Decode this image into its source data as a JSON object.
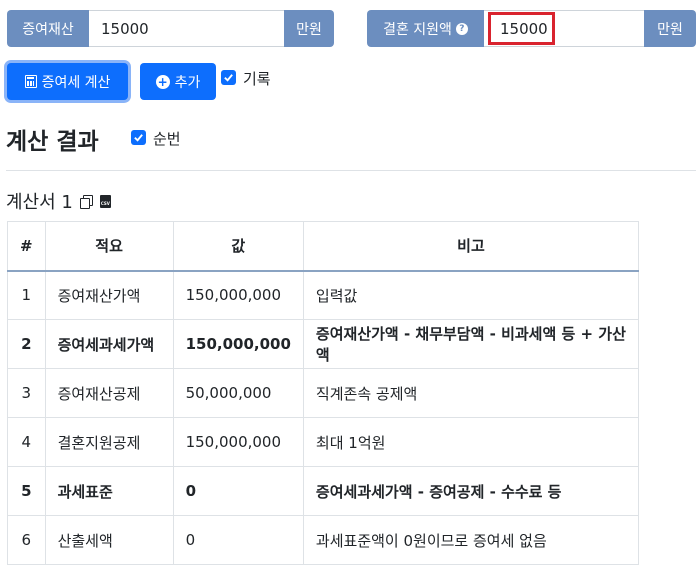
{
  "inputs": {
    "gift_property": {
      "label": "증여재산",
      "value": "15000",
      "unit": "만원"
    },
    "marriage_support": {
      "label": "결혼 지원액",
      "help": "?",
      "value": "15000",
      "unit": "만원"
    }
  },
  "buttons": {
    "calculate": "증여세 계산",
    "add": "추가",
    "add_icon": "+"
  },
  "record_checkbox": {
    "label": "기록",
    "checked": true
  },
  "result": {
    "title": "계산 결과",
    "order_checkbox": {
      "label": "순번",
      "checked": true
    },
    "sheet_title": "계산서 1",
    "csv_label": "CSV"
  },
  "table": {
    "headers": [
      "#",
      "적요",
      "값",
      "비고"
    ],
    "rows": [
      {
        "no": "1",
        "item": "증여재산가액",
        "value": "150,000,000",
        "note": "입력값",
        "bold": false
      },
      {
        "no": "2",
        "item": "증여세과세가액",
        "value": "150,000,000",
        "note": "증여재산가액 - 채무부담액 - 비과세액 등 + 가산액",
        "bold": true
      },
      {
        "no": "3",
        "item": "증여재산공제",
        "value": "50,000,000",
        "note": "직계존속 공제액",
        "bold": false
      },
      {
        "no": "4",
        "item": "결혼지원공제",
        "value": "150,000,000",
        "note": "최대 1억원",
        "bold": false
      },
      {
        "no": "5",
        "item": "과세표준",
        "value": "0",
        "note": "증여세과세가액 - 증여공제 - 수수료 등",
        "bold": true
      },
      {
        "no": "6",
        "item": "산출세액",
        "value": "0",
        "note": "과세표준액이 0원이므로 증여세 없음",
        "bold": false
      }
    ]
  },
  "colors": {
    "addon_bg": "#6c8ebf",
    "primary": "#0d6efd",
    "highlight_border": "#d9232e"
  }
}
